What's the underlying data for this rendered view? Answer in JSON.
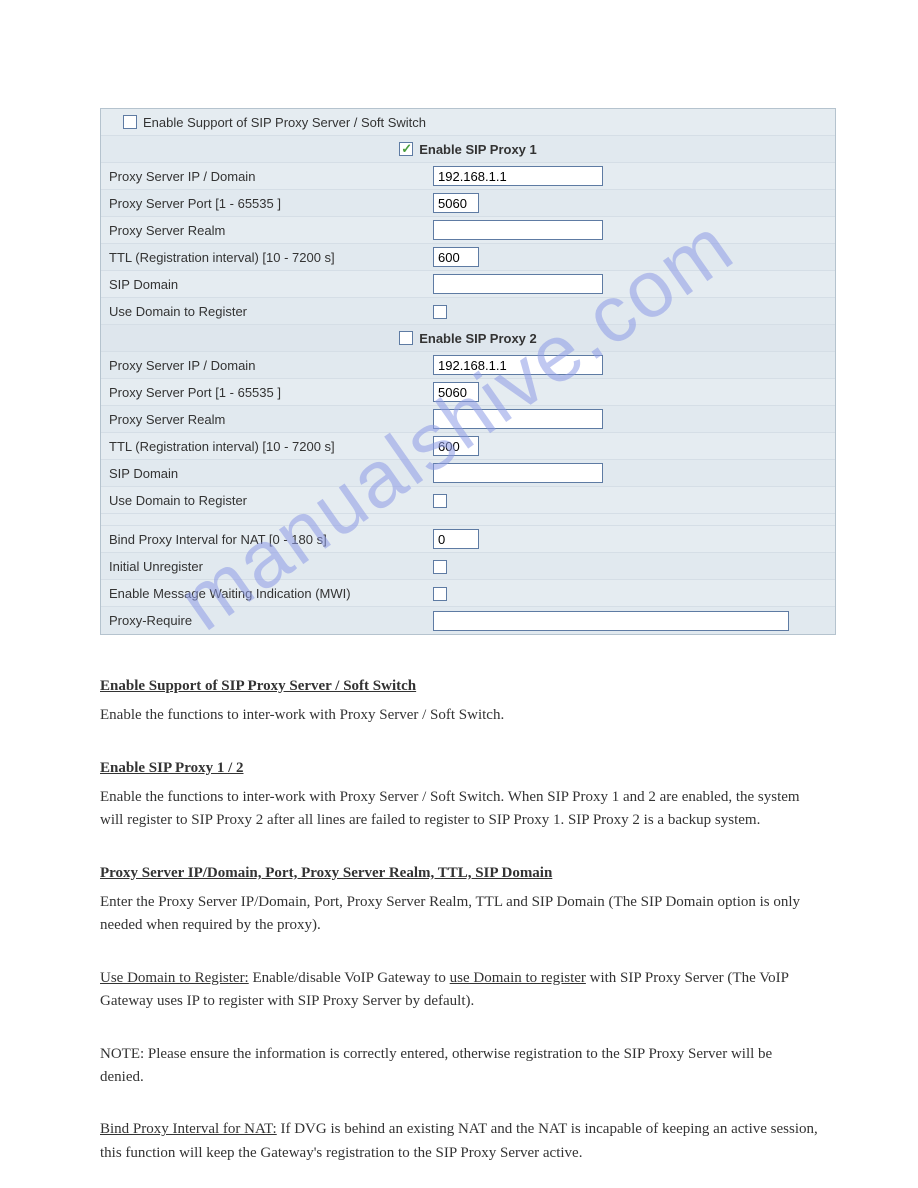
{
  "form": {
    "enable_support_label": "Enable Support of SIP Proxy Server / Soft Switch",
    "proxy1": {
      "header": "Enable SIP Proxy 1",
      "ip_label": "Proxy Server IP / Domain",
      "ip_value": "192.168.1.1",
      "port_label": "Proxy Server Port [1 - 65535 ]",
      "port_value": "5060",
      "realm_label": "Proxy Server Realm",
      "realm_value": "",
      "ttl_label": "TTL (Registration interval) [10 - 7200 s]",
      "ttl_value": "600",
      "sipdomain_label": "SIP Domain",
      "sipdomain_value": "",
      "usedomain_label": "Use Domain to Register"
    },
    "proxy2": {
      "header": "Enable SIP Proxy 2",
      "ip_label": "Proxy Server IP / Domain",
      "ip_value": "192.168.1.1",
      "port_label": "Proxy Server Port [1 - 65535 ]",
      "port_value": "5060",
      "realm_label": "Proxy Server Realm",
      "realm_value": "",
      "ttl_label": "TTL (Registration interval) [10 - 7200 s]",
      "ttl_value": "600",
      "sipdomain_label": "SIP Domain",
      "sipdomain_value": "",
      "usedomain_label": "Use Domain to Register"
    },
    "bind_label": "Bind Proxy Interval for NAT [0 - 180 s]",
    "bind_value": "0",
    "initial_unreg_label": "Initial Unregister",
    "mwi_label": "Enable Message Waiting Indication (MWI)",
    "proxyrequire_label": "Proxy-Require",
    "proxyrequire_value": ""
  },
  "doc": {
    "p1a": "Enable Support of SIP Proxy Server / Soft Switch",
    "p1b": "Enable the functions to inter-work with Proxy Server / Soft Switch.",
    "p2a": "Enable SIP Proxy 1 / 2",
    "p2b": "Enable the functions to inter-work with Proxy Server / Soft Switch. When SIP Proxy 1 and 2 are enabled, the system will register to SIP Proxy 2 after all lines are failed to register to SIP Proxy 1. SIP Proxy 2 is a backup system.",
    "p3a": "Proxy Server IP/Domain, Port, Proxy Server Realm, TTL, SIP Domain",
    "p3b": "Enter the Proxy Server IP/Domain, Port, Proxy Server Realm, TTL and SIP Domain (The SIP Domain option is only needed when required by the proxy).",
    "p4a": "Use Domain to Register:",
    "p4b": " Enable/disable VoIP Gateway to ",
    "p4c": "use Domain to register",
    "p4d": " with SIP Proxy Server (The VoIP Gateway uses IP to register with SIP Proxy Server by default).",
    "p5": "NOTE: Please ensure the information is correctly entered, otherwise registration to the SIP Proxy Server will be denied.",
    "p6a": "Bind Proxy Interval for NAT:",
    "p6b": " If DVG is behind an existing NAT and the NAT is incapable of keeping an active session, this function will keep the Gateway's registration to the SIP Proxy Server active."
  },
  "watermark": "manualshive.com"
}
